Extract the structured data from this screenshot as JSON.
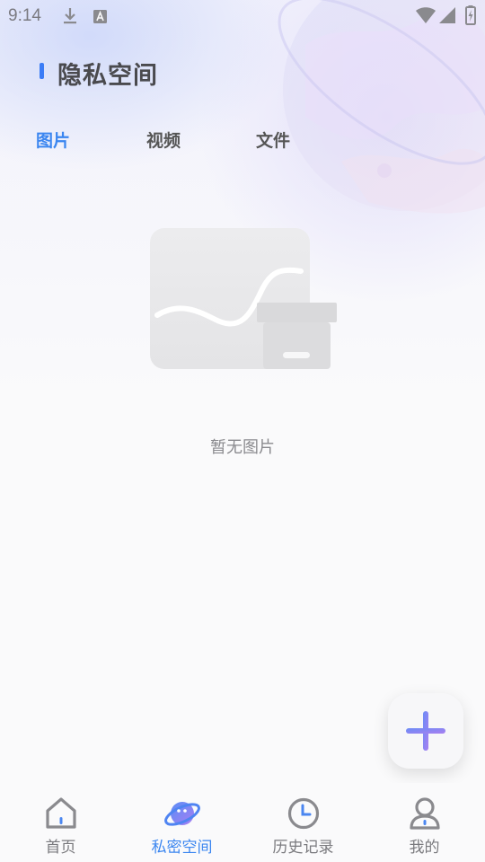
{
  "status_bar": {
    "time": "9:14",
    "icons": [
      "download-icon",
      "a-notification-icon",
      "wifi-icon",
      "signal-icon",
      "battery-charging-icon"
    ]
  },
  "header": {
    "title": "隐私空间"
  },
  "tabs": [
    {
      "label": "图片",
      "active": true
    },
    {
      "label": "视频",
      "active": false
    },
    {
      "label": "文件",
      "active": false
    }
  ],
  "empty_state": {
    "icon": "empty-box-illustration",
    "text": "暂无图片"
  },
  "fab": {
    "icon": "plus-icon"
  },
  "bottom_nav": {
    "items": [
      {
        "label": "首页",
        "icon": "home-icon",
        "active": false
      },
      {
        "label": "私密空间",
        "icon": "planet-icon",
        "active": true
      },
      {
        "label": "历史记录",
        "icon": "clock-icon",
        "active": false
      },
      {
        "label": "我的",
        "icon": "person-icon",
        "active": false
      }
    ]
  },
  "colors": {
    "accent": "#3b86f0",
    "title_bar": "#3b7cf6",
    "text_primary": "#4a4a4e",
    "text_secondary": "#8a8a8e",
    "fab_gradient_start": "#6b8cf6",
    "fab_gradient_end": "#a97ff0"
  }
}
